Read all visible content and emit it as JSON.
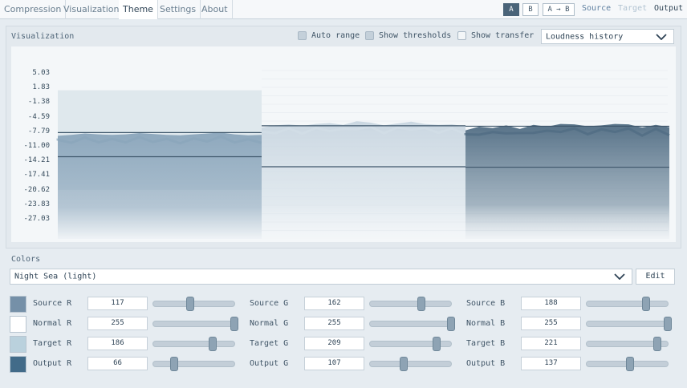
{
  "tabs": [
    {
      "label": "Compression",
      "active": false
    },
    {
      "label": "Visualization",
      "active": false
    },
    {
      "label": "Theme",
      "active": true
    },
    {
      "label": "Settings",
      "active": false
    },
    {
      "label": "About",
      "active": false
    }
  ],
  "ab": {
    "a": "A",
    "b": "B",
    "ab": "A → B"
  },
  "modes": {
    "source": "Source",
    "target": "Target",
    "output": "Output"
  },
  "visualization": {
    "title": "Visualization",
    "auto_range": "Auto range",
    "show_thresholds": "Show thresholds",
    "show_transfer": "Show transfer",
    "view_select": "Loudness history"
  },
  "chart_data": {
    "type": "area",
    "y_ticks": [
      "5.03",
      "1.83",
      "-1.38",
      "-4.59",
      "-7.79",
      "-11.00",
      "-14.21",
      "-17.41",
      "-20.62",
      "-23.83",
      "-27.03"
    ],
    "ylim": [
      -27.03,
      5.03
    ],
    "grid": true,
    "series": [
      {
        "color": "#8aa5bb",
        "values": [
          -8.6,
          -8.4,
          -8.1,
          -8.3,
          -8.4,
          -8.3,
          -8.0,
          -8.2,
          -8.4,
          -8.5,
          -8.3,
          -8.1,
          -7.9,
          -8.3,
          -8.5,
          -8.4
        ],
        "thresholds": [
          -7.9,
          -13.2
        ]
      },
      {
        "color": "#d3dee7",
        "values": [
          -6.8,
          -6.3,
          -6.1,
          -6.4,
          -6.0,
          -5.8,
          -6.2,
          -5.4,
          -5.7,
          -6.3,
          -5.9,
          -5.5,
          -6.0,
          -6.2,
          -6.1,
          -6.5
        ],
        "thresholds": [
          -6.4,
          -15.4
        ]
      },
      {
        "color": "#4f6b82",
        "values": [
          -7.4,
          -6.6,
          -6.9,
          -6.3,
          -7.1,
          -6.2,
          -6.6,
          -6.0,
          -6.1,
          -6.5,
          -6.3,
          -6.0,
          -6.1,
          -6.8,
          -6.2,
          -6.7
        ],
        "thresholds": [
          -6.5,
          -15.5
        ]
      }
    ]
  },
  "colors": {
    "title": "Colors",
    "preset": "Night Sea (light)",
    "edit": "Edit",
    "rows": [
      {
        "swatch": "#7590a8",
        "r_label": "Source R",
        "r": "117",
        "g_label": "Source G",
        "g": "162",
        "b_label": "Source B",
        "b": "188",
        "r_frac": 0.459,
        "g_frac": 0.635,
        "b_frac": 0.737
      },
      {
        "swatch": "#ffffff",
        "r_label": "Normal R",
        "r": "255",
        "g_label": "Normal G",
        "g": "255",
        "b_label": "Normal B",
        "b": "255",
        "r_frac": 1.0,
        "g_frac": 1.0,
        "b_frac": 1.0
      },
      {
        "swatch": "#bad1dd",
        "r_label": "Target R",
        "r": "186",
        "g_label": "Target G",
        "g": "209",
        "b_label": "Target B",
        "b": "221",
        "r_frac": 0.729,
        "g_frac": 0.82,
        "b_frac": 0.867
      },
      {
        "swatch": "#426b89",
        "r_label": "Output R",
        "r": "66",
        "g_label": "Output G",
        "g": "107",
        "b_label": "Output B",
        "b": "137",
        "r_frac": 0.259,
        "g_frac": 0.42,
        "b_frac": 0.537
      }
    ]
  }
}
